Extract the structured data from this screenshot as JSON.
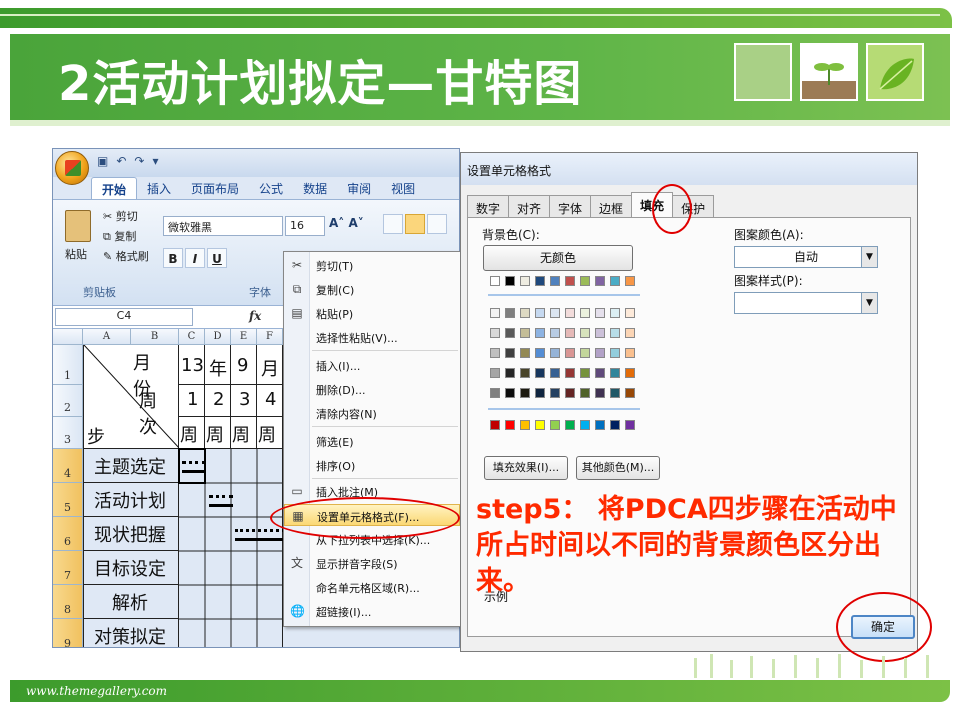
{
  "slide": {
    "title": "2活动计划拟定—甘特图",
    "footer_url": "www.themegallery.com"
  },
  "excel": {
    "tabs": [
      "开始",
      "插入",
      "页面布局",
      "公式",
      "数据",
      "审阅",
      "视图"
    ],
    "active_tab": "开始",
    "clipboard": {
      "paste": "粘贴",
      "cut": "剪切",
      "copy": "复制",
      "format_painter": "格式刷",
      "group": "剪贴板"
    },
    "font": {
      "name": "微软雅黑",
      "size": "16",
      "group": "字体"
    },
    "name_box": "C4",
    "columns": [
      "A",
      "B",
      "C",
      "D",
      "E",
      "F"
    ],
    "rows": [
      "1",
      "2",
      "3",
      "4",
      "5",
      "6",
      "7",
      "8",
      "9"
    ],
    "header": {
      "month_label": "月份",
      "week_label": "周次",
      "step_label": "步骤",
      "year_val": "13",
      "year_unit": "年",
      "month_val": "9",
      "month_unit": "月",
      "weeks": [
        "1",
        "2",
        "3",
        "4"
      ],
      "week_unit": "周"
    },
    "steps": [
      "主题选定",
      "活动计划",
      "现状把握",
      "目标设定",
      "解析",
      "对策拟定"
    ]
  },
  "context_menu": {
    "items": [
      {
        "icon": "scissors-icon",
        "label": "剪切(T)"
      },
      {
        "icon": "copy-icon",
        "label": "复制(C)"
      },
      {
        "icon": "paste-icon",
        "label": "粘贴(P)"
      },
      {
        "icon": "",
        "label": "选择性粘贴(V)..."
      },
      {
        "icon": "",
        "label": "插入(I)..."
      },
      {
        "icon": "",
        "label": "删除(D)..."
      },
      {
        "icon": "",
        "label": "清除内容(N)"
      },
      {
        "icon": "",
        "label": "筛选(E)"
      },
      {
        "icon": "",
        "label": "排序(O)"
      },
      {
        "icon": "comment-icon",
        "label": "插入批注(M)"
      },
      {
        "icon": "format-cells-icon",
        "label": "设置单元格格式(F)..."
      },
      {
        "icon": "",
        "label": "从下拉列表中选择(K)..."
      },
      {
        "icon": "phonetic-icon",
        "label": "显示拼音字段(S)"
      },
      {
        "icon": "",
        "label": "命名单元格区域(R)..."
      },
      {
        "icon": "hyperlink-icon",
        "label": "超链接(I)..."
      }
    ],
    "highlighted_index": 10
  },
  "dialog": {
    "title": "设置单元格格式",
    "tabs": [
      "数字",
      "对齐",
      "字体",
      "边框",
      "填充",
      "保护"
    ],
    "active_tab": "填充",
    "bg_color_label": "背景色(C):",
    "no_color": "无颜色",
    "pattern_color_label": "图案颜色(A):",
    "pattern_color_value": "自动",
    "pattern_style_label": "图案样式(P):",
    "fill_effects": "填充效果(I)...",
    "more_colors": "其他颜色(M)...",
    "sample_label": "示例",
    "ok": "确定",
    "theme_row": [
      "#ffffff",
      "#000000",
      "#eeece1",
      "#1f497d",
      "#4f81bd",
      "#c0504d",
      "#9bbb59",
      "#8064a2",
      "#4bacc6",
      "#f79646"
    ],
    "tint_rows": [
      [
        "#f2f2f2",
        "#7f7f7f",
        "#ddd9c3",
        "#c6d9f0",
        "#dbe5f1",
        "#f2dcdb",
        "#ebf1dd",
        "#e5e0ec",
        "#dbeef3",
        "#fdeada"
      ],
      [
        "#d8d8d8",
        "#595959",
        "#c4bd97",
        "#8db3e2",
        "#b8cce4",
        "#e5b9b7",
        "#d7e3bc",
        "#ccc1d9",
        "#b7dde8",
        "#fbd5b5"
      ],
      [
        "#bfbfbf",
        "#3f3f3f",
        "#938953",
        "#548dd4",
        "#95b3d7",
        "#d99694",
        "#c3d69b",
        "#b2a2c7",
        "#92cddc",
        "#fac08f"
      ],
      [
        "#a5a5a5",
        "#262626",
        "#494429",
        "#17365d",
        "#366092",
        "#953734",
        "#76923c",
        "#5f497a",
        "#31859b",
        "#e36c09"
      ],
      [
        "#7f7f7f",
        "#0c0c0c",
        "#1d1b10",
        "#0f243e",
        "#244061",
        "#632423",
        "#4f6128",
        "#3f3151",
        "#205867",
        "#974806"
      ]
    ],
    "standard_row": [
      "#c00000",
      "#ff0000",
      "#ffc000",
      "#ffff00",
      "#92d050",
      "#00b050",
      "#00b0f0",
      "#0070c0",
      "#002060",
      "#7030a0"
    ]
  },
  "annotation": {
    "step_text": "step5： 将PDCA四步骤在活动中所占时间以不同的背景颜色区分出来。"
  },
  "colors": {
    "accent_green": "#4aa43a",
    "annotation_red": "#ff2a00"
  }
}
